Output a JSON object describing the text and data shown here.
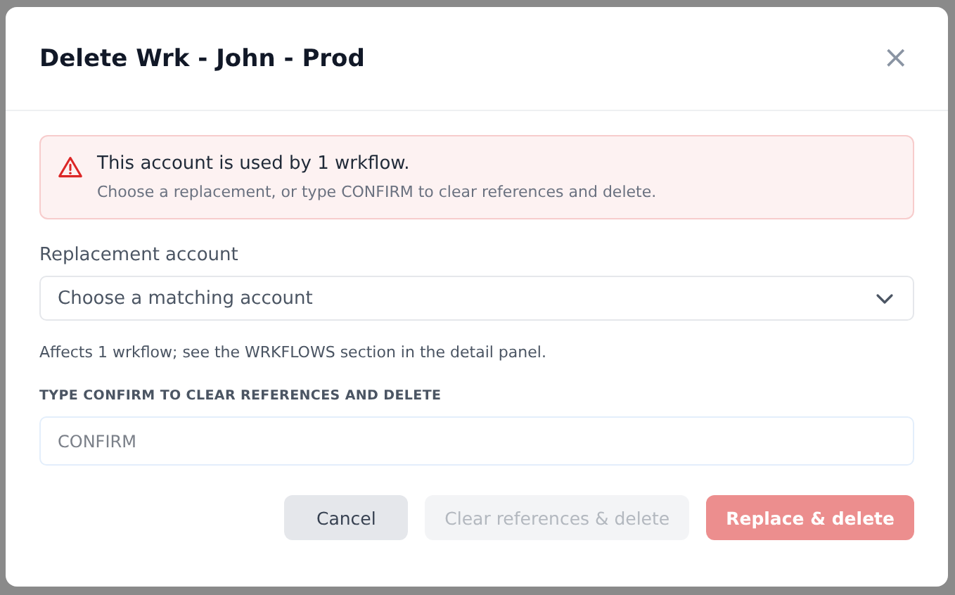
{
  "dialog": {
    "title": "Delete Wrk - John - Prod",
    "close": "×"
  },
  "alert": {
    "title": "This account is used by 1 wrkflow.",
    "message": "Choose a replacement, or type CONFIRM to clear references and delete."
  },
  "replacement": {
    "label": "Replacement account",
    "placeholder": "Choose a matching account",
    "help": "Affects 1 wrkflow; see the WRKFLOWS section in the detail panel."
  },
  "confirm": {
    "label": "TYPE CONFIRM TO CLEAR REFERENCES AND DELETE",
    "placeholder": "CONFIRM"
  },
  "buttons": [
    {
      "label": "Cancel",
      "kind": "secondary",
      "disabled": false
    },
    {
      "label": "Clear references & delete",
      "kind": "secondary",
      "disabled": true
    },
    {
      "label": "Replace & delete",
      "kind": "danger",
      "disabled": true
    }
  ]
}
